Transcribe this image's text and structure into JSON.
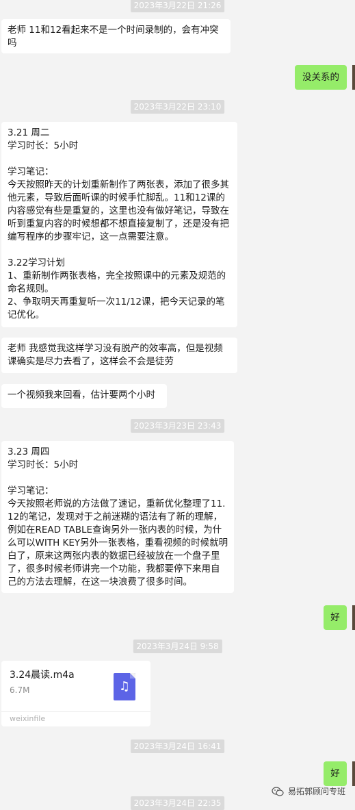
{
  "timestamps": [
    "2023年3月22日 21:26",
    "2023年3月22日 23:10",
    "2023年3月23日 23:43",
    "2023年3月24日 9:58",
    "2023年3月24日 16:41",
    "2023年3月24日 22:35"
  ],
  "messages": {
    "m1": "老师 11和12看起来不是一个时间录制的，会有冲突吗",
    "m2": "没关系的",
    "m3": "3.21 周二\n学习时长：5小时\n\n学习笔记：\n今天按照昨天的计划重新制作了两张表，添加了很多其他元素，导致后面听课的时候手忙脚乱。11和12课的内容感觉有些是重复的，这里也没有做好笔记，导致在听到重复内容的时候想都不想直接复制了，还是没有把编写程序的步骤牢记，这一点需要注意。\n\n3.22学习计划\n1、重新制作两张表格，完全按照课中的元素及规范的命名规则。\n2、争取明天再重复听一次11/12课，把今天记录的笔记优化。",
    "m4": "老师 我感觉我这样学习没有脱产的效率高，但是视频课确实是尽力去看了，这样会不会是徒劳",
    "m5": "一个视频我来回看，估计要两个小时",
    "m6": "3.23 周四\n学习时长：5小时\n\n学习笔记：\n今天按照老师说的方法做了速记，重新优化整理了11.12的笔记，发现对于之前迷糊的语法有了新的理解，例如在READ TABLE查询另外一张内表的时候，为什么可以WITH KEY另外一张表格，重看视频的时候就明白了，原来这两张内表的数据已经被放在一个盘子里了，很多时候老师讲完一个功能，我都要停下来用自己的方法去理解，在这一块浪费了很多时间。",
    "m7": "好",
    "m9": "好"
  },
  "file": {
    "name": "3.24晨读.m4a",
    "size": "6.7M",
    "source": "weixinfile",
    "icon": "music-file-icon",
    "icon_color": "#5c64e6"
  },
  "watermark": {
    "text": "易拓郭顾问专班",
    "icon": "wechat-official-account-icon"
  },
  "colors": {
    "background": "#f3f3f3",
    "outgoing_bubble": "#95ec69",
    "incoming_bubble": "#ffffff",
    "timestamp_pill": "#dadada"
  }
}
